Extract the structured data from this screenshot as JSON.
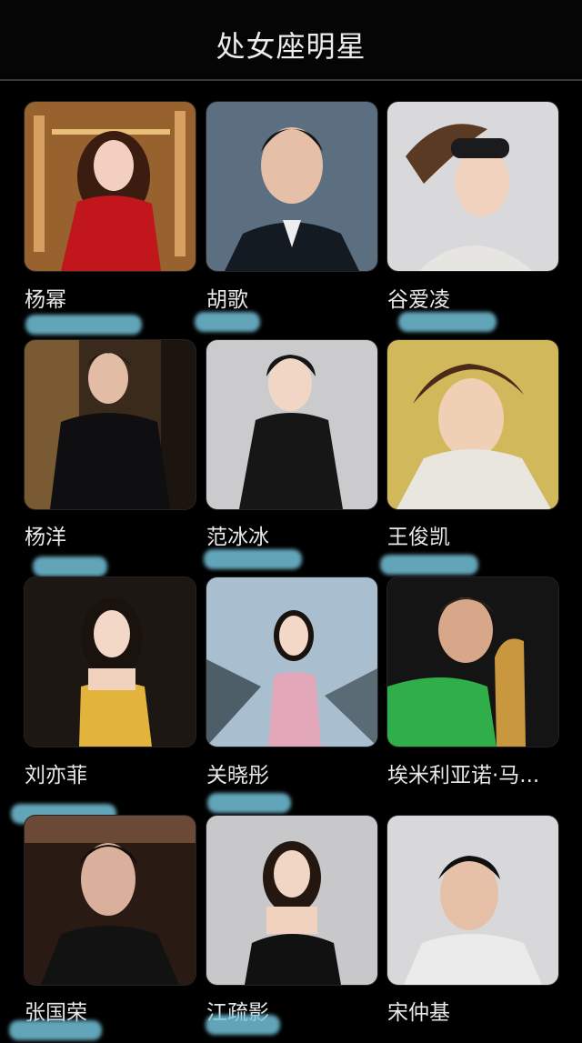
{
  "header": {
    "title": "处女座明星"
  },
  "celebrities": [
    {
      "name": "杨幂"
    },
    {
      "name": "胡歌"
    },
    {
      "name": "谷爱凌"
    },
    {
      "name": "杨洋"
    },
    {
      "name": "范冰冰"
    },
    {
      "name": "王俊凯"
    },
    {
      "name": "刘亦菲"
    },
    {
      "name": "关晓彤"
    },
    {
      "name": "埃米利亚诺·马..."
    },
    {
      "name": "张国荣"
    },
    {
      "name": "江疏影"
    },
    {
      "name": "宋仲基"
    }
  ],
  "colors": {
    "background": "#000000",
    "text": "#e8e8e8",
    "redaction": "#78c8e1"
  }
}
